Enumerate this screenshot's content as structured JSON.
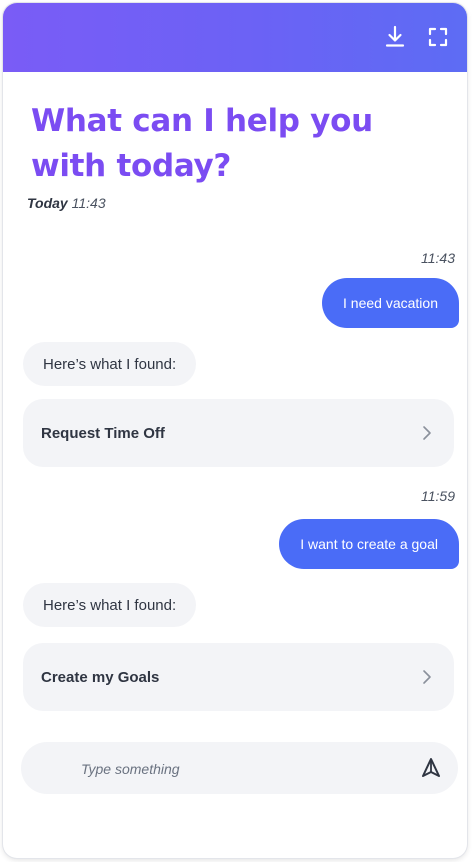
{
  "header": {
    "download_icon": "download-icon",
    "fullscreen_icon": "fullscreen-icon",
    "gradient_start": "#7a5cf6",
    "gradient_end": "#5d6cf4"
  },
  "title": "What can I help you with today?",
  "today": {
    "label": "Today",
    "time": "11:43"
  },
  "conversation": [
    {
      "timestamp": "11:43",
      "user_message": "I need vacation",
      "bot_message": "Here’s what I found:",
      "result_label": "Request Time Off"
    },
    {
      "timestamp": "11:59",
      "user_message": "I want to create a goal",
      "bot_message": "Here’s what I found:",
      "result_label": "Create my Goals"
    }
  ],
  "input": {
    "placeholder": "Type something",
    "value": "",
    "send_icon": "send-icon"
  },
  "colors": {
    "title": "#7b4cf2",
    "user_bubble": "#4a6cf7",
    "bot_bubble": "#f3f4f7"
  }
}
